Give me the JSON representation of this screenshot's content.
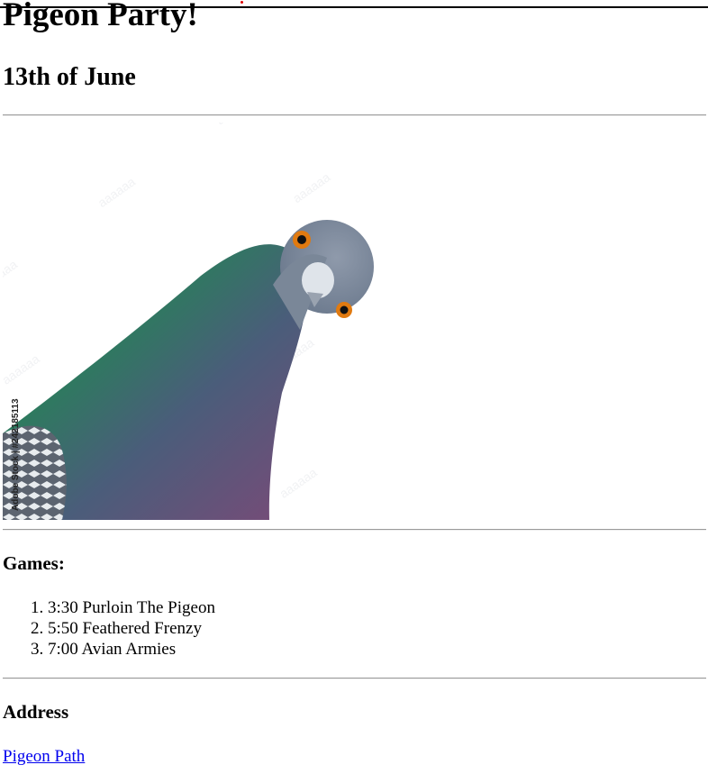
{
  "page": {
    "title": "Pigeon Party!",
    "date": "13th of June"
  },
  "image": {
    "subject": "pigeon",
    "watermark_text": "Adobe Stock | #242185113"
  },
  "games": {
    "heading": "Games:",
    "items": [
      {
        "time": "3:30",
        "name": "Purloin The Pigeon",
        "label": "3:30 Purloin The Pigeon"
      },
      {
        "time": "5:50",
        "name": "Feathered Frenzy",
        "label": "5:50 Feathered Frenzy"
      },
      {
        "time": "7:00",
        "name": "Avian Armies",
        "label": "7:00 Avian Armies"
      }
    ]
  },
  "address": {
    "heading": "Address",
    "link_text": "Pigeon Path"
  },
  "colors": {
    "link": "#0000ee",
    "rule": "#9a9a9a",
    "pigeon_head": "#7d8a9c",
    "pigeon_neck_green": "#2f7a5e",
    "pigeon_neck_purple": "#7a4a7a",
    "eye": "#e07a10"
  }
}
